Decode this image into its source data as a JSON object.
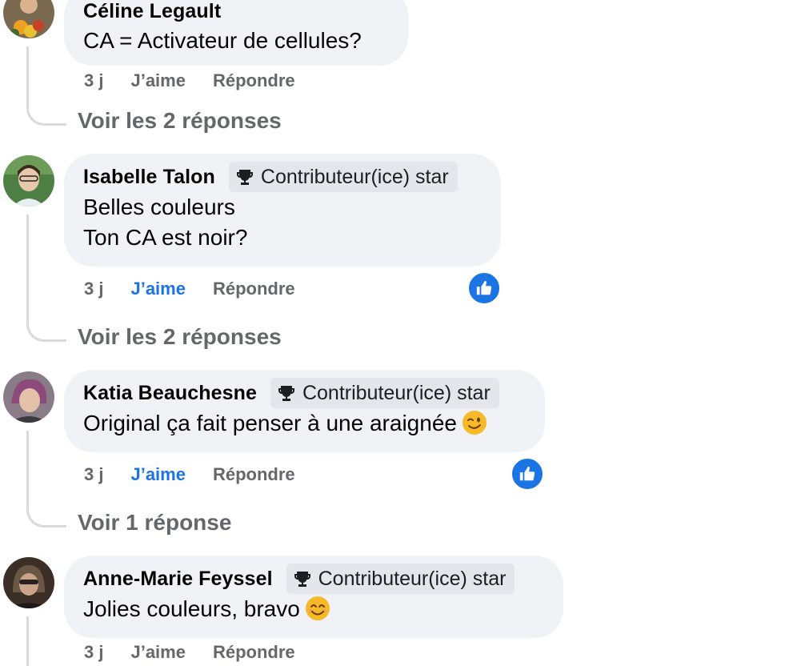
{
  "comments": [
    {
      "author": "Céline Legault",
      "badge": "",
      "lines": [
        "CA = Activateur de cellules?"
      ],
      "time": "3 j",
      "like": "J’aime",
      "reply": "Répondre",
      "replies_link": "Voir les 2 réponses"
    },
    {
      "author": "Isabelle Talon",
      "badge": "Contributeur(ice) star",
      "lines": [
        "Belles couleurs",
        "Ton CA est noir?"
      ],
      "time": "3 j",
      "like": "J’aime",
      "reply": "Répondre",
      "replies_link": "Voir les 2 réponses"
    },
    {
      "author": "Katia Beauchesne",
      "badge": "Contributeur(ice) star",
      "lines": [
        "Original ça fait penser à une araignée"
      ],
      "time": "3 j",
      "like": "J’aime",
      "reply": "Répondre",
      "replies_link": "Voir 1 réponse"
    },
    {
      "author": "Anne-Marie Feyssel",
      "badge": "Contributeur(ice) star",
      "lines": [
        "Jolies couleurs, bravo"
      ],
      "time": "3 j",
      "like": "J’aime",
      "reply": "Répondre"
    }
  ],
  "colors": {
    "bubble": "#f0f2f5",
    "badge": "#e4e6eb",
    "liked_blue": "#1b74e4",
    "muted_text": "#65676b",
    "thread_line": "#d8dadf"
  },
  "icons": {
    "trophy": "trophy-icon",
    "like_reaction": "thumbs-up-icon",
    "wink_emoji": "winking-face-emoji",
    "smile_emoji": "smiling-face-emoji"
  }
}
